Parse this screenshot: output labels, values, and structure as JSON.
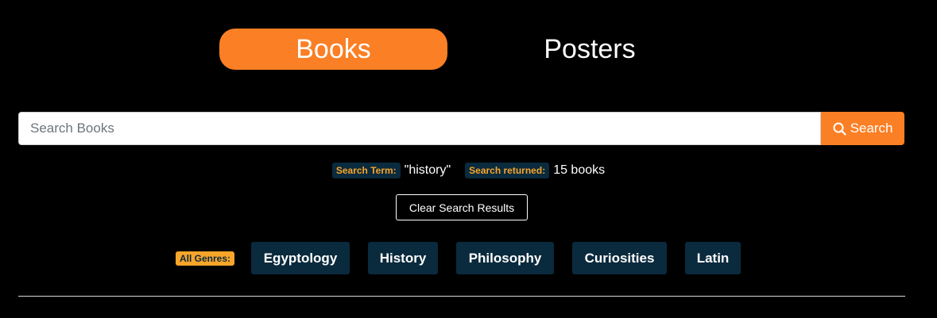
{
  "tabs": {
    "books": "Books",
    "posters": "Posters"
  },
  "search": {
    "placeholder": "Search Books",
    "value": "",
    "button_label": "Search",
    "button_icon": "search-icon"
  },
  "status": {
    "term_label": "Search Term:",
    "term_value": "\"history\"",
    "returned_label": "Search returned:",
    "returned_value": "15 books"
  },
  "clear_button_label": "Clear Search Results",
  "genres": {
    "label": "All Genres:",
    "items": [
      "Egyptology",
      "History",
      "Philosophy",
      "Curiosities",
      "Latin"
    ]
  },
  "colors": {
    "accent": "#fb7f24",
    "badge_bg": "#0a2a3d",
    "badge_text": "#f9a52a",
    "background": "#000000"
  }
}
